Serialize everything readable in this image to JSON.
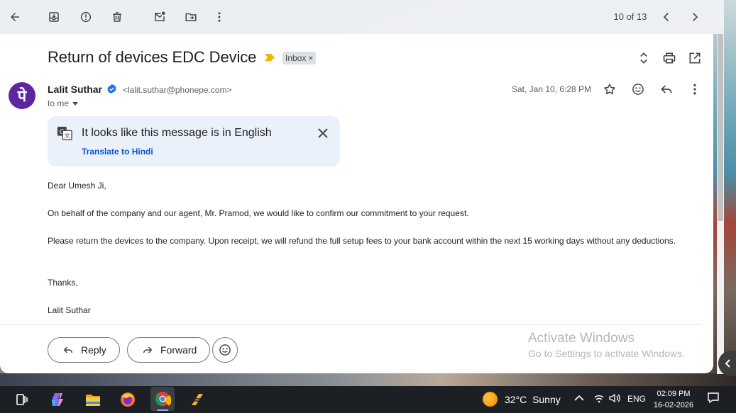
{
  "toolbar": {
    "back_icon": "arrow-left-icon",
    "archive_icon": "archive-icon",
    "spam_icon": "report-spam-icon",
    "delete_icon": "trash-icon",
    "mark_unread_icon": "mark-unread-icon",
    "move_icon": "move-to-folder-icon",
    "more_icon": "more-vert-icon",
    "pager_text": "10 of 13",
    "prev_icon": "chevron-left-icon",
    "next_icon": "chevron-right-icon"
  },
  "email": {
    "subject": "Return of devices EDC Device",
    "label": "Inbox",
    "label_close": "×",
    "sender": {
      "avatar_glyph": "पे",
      "avatar_color": "#5f259f",
      "name": "Lalit Suthar",
      "email": "<lalit.suthar@phonepe.com>",
      "to_text": "to me"
    },
    "timestamp": "Sat, Jan 10, 6:28 PM",
    "translate": {
      "message": "It looks like this message is in English",
      "link": "Translate to Hindi"
    },
    "body": {
      "greeting": "Dear Umesh Ji,",
      "para1": "On behalf of the company and our agent, Mr. Pramod, we would like to confirm our commitment to your request.",
      "para2": "Please return the devices to the company. Upon receipt, we will refund the full setup fees to your bank account within the next 15 working days without any deductions.",
      "closing": "Thanks,",
      "signature": "Lalit Suthar"
    }
  },
  "actions": {
    "reply_label": "Reply",
    "forward_label": "Forward"
  },
  "watermark": {
    "line1": "Activate Windows",
    "line2": "Go to Settings to activate Windows."
  },
  "taskbar": {
    "apps": [
      "task-view-icon",
      "copilot-icon",
      "file-explorer-icon",
      "firefox-icon",
      "chrome-icon",
      "app-icon"
    ],
    "weather_temp": "32°C",
    "weather_desc": "Sunny",
    "language": "ENG",
    "time": "02:09 PM",
    "date": "16-02-2026"
  },
  "colors": {
    "accent_blue": "#0b57d0",
    "important_yellow": "#f4b400",
    "verified_blue": "#1a73e8"
  }
}
